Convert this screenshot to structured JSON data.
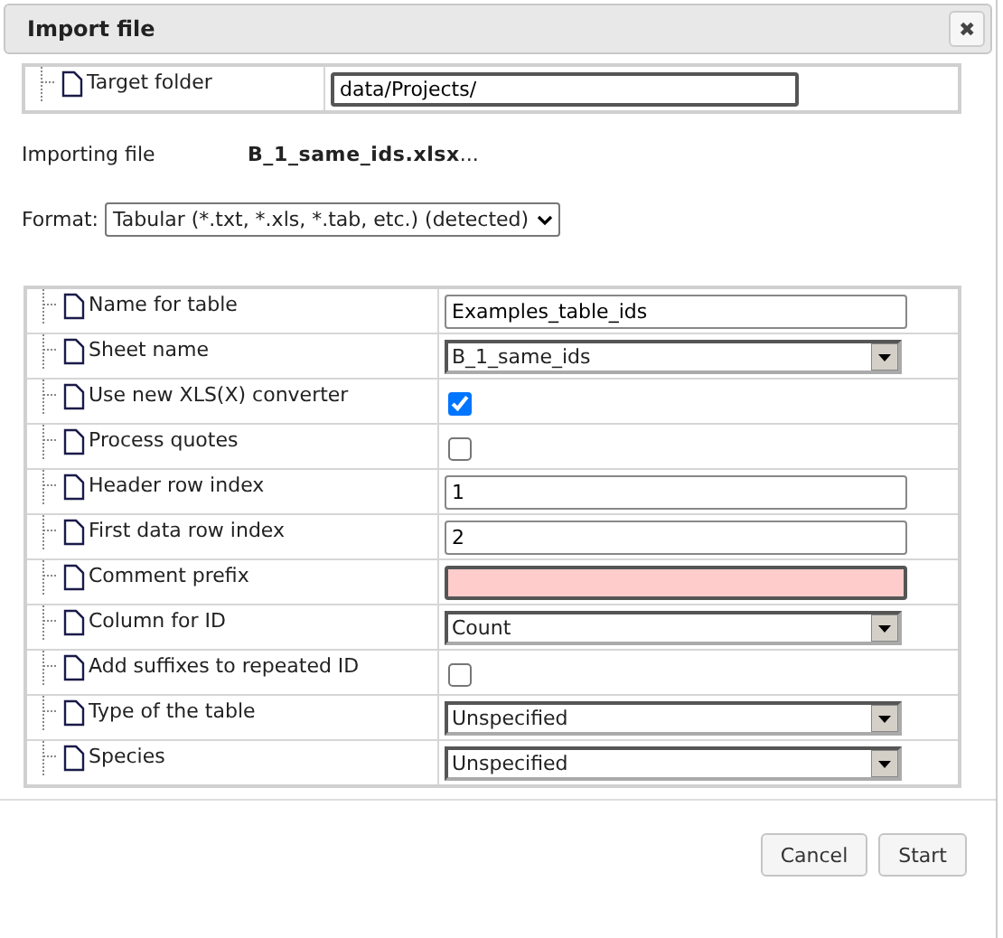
{
  "window": {
    "title": "Import file",
    "close": "✖"
  },
  "target": {
    "label": "Target folder",
    "value": "data/Projects/"
  },
  "importing": {
    "label": "Importing file",
    "file": "B_1_same_ids.xlsx",
    "ellipsis": "..."
  },
  "format": {
    "label": "Format:",
    "value": "Tabular (*.txt, *.xls, *.tab, etc.) (detected)"
  },
  "options": [
    {
      "label": "Name for table",
      "kind": "text",
      "value": "Examples_table_ids",
      "invalid": false
    },
    {
      "label": "Sheet name",
      "kind": "select",
      "value": "B_1_same_ids"
    },
    {
      "label": "Use new XLS(X) converter",
      "kind": "checkbox",
      "checked": true
    },
    {
      "label": "Process quotes",
      "kind": "checkbox",
      "checked": false
    },
    {
      "label": "Header row index",
      "kind": "text",
      "value": "1",
      "invalid": false
    },
    {
      "label": "First data row index",
      "kind": "text",
      "value": "2",
      "invalid": false
    },
    {
      "label": "Comment prefix",
      "kind": "text",
      "invalid": true
    },
    {
      "label": "Column for ID",
      "kind": "select",
      "value": "Count"
    },
    {
      "label": "Add suffixes to repeated ID",
      "kind": "checkbox",
      "checked": false
    },
    {
      "label": "Type of the table",
      "kind": "select",
      "value": "Unspecified"
    },
    {
      "label": "Species",
      "kind": "select",
      "value": "Unspecified"
    }
  ],
  "buttons": [
    "Cancel",
    "Start"
  ]
}
